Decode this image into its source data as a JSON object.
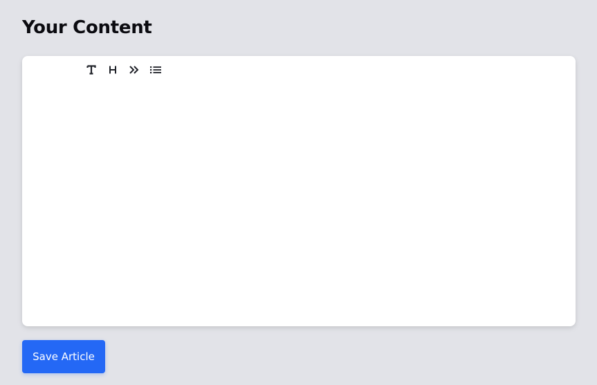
{
  "header": {
    "title": "Your Content"
  },
  "editor": {
    "toolbar": [
      {
        "name": "text",
        "icon": "text-icon"
      },
      {
        "name": "heading",
        "icon": "heading-icon"
      },
      {
        "name": "quote",
        "icon": "quote-icon"
      },
      {
        "name": "list",
        "icon": "list-icon"
      }
    ],
    "content": ""
  },
  "actions": {
    "save_label": "Save Article"
  },
  "colors": {
    "background": "#e2e3e8",
    "editor_bg": "#ffffff",
    "primary": "#2468f5",
    "icon": "#1f2128"
  }
}
